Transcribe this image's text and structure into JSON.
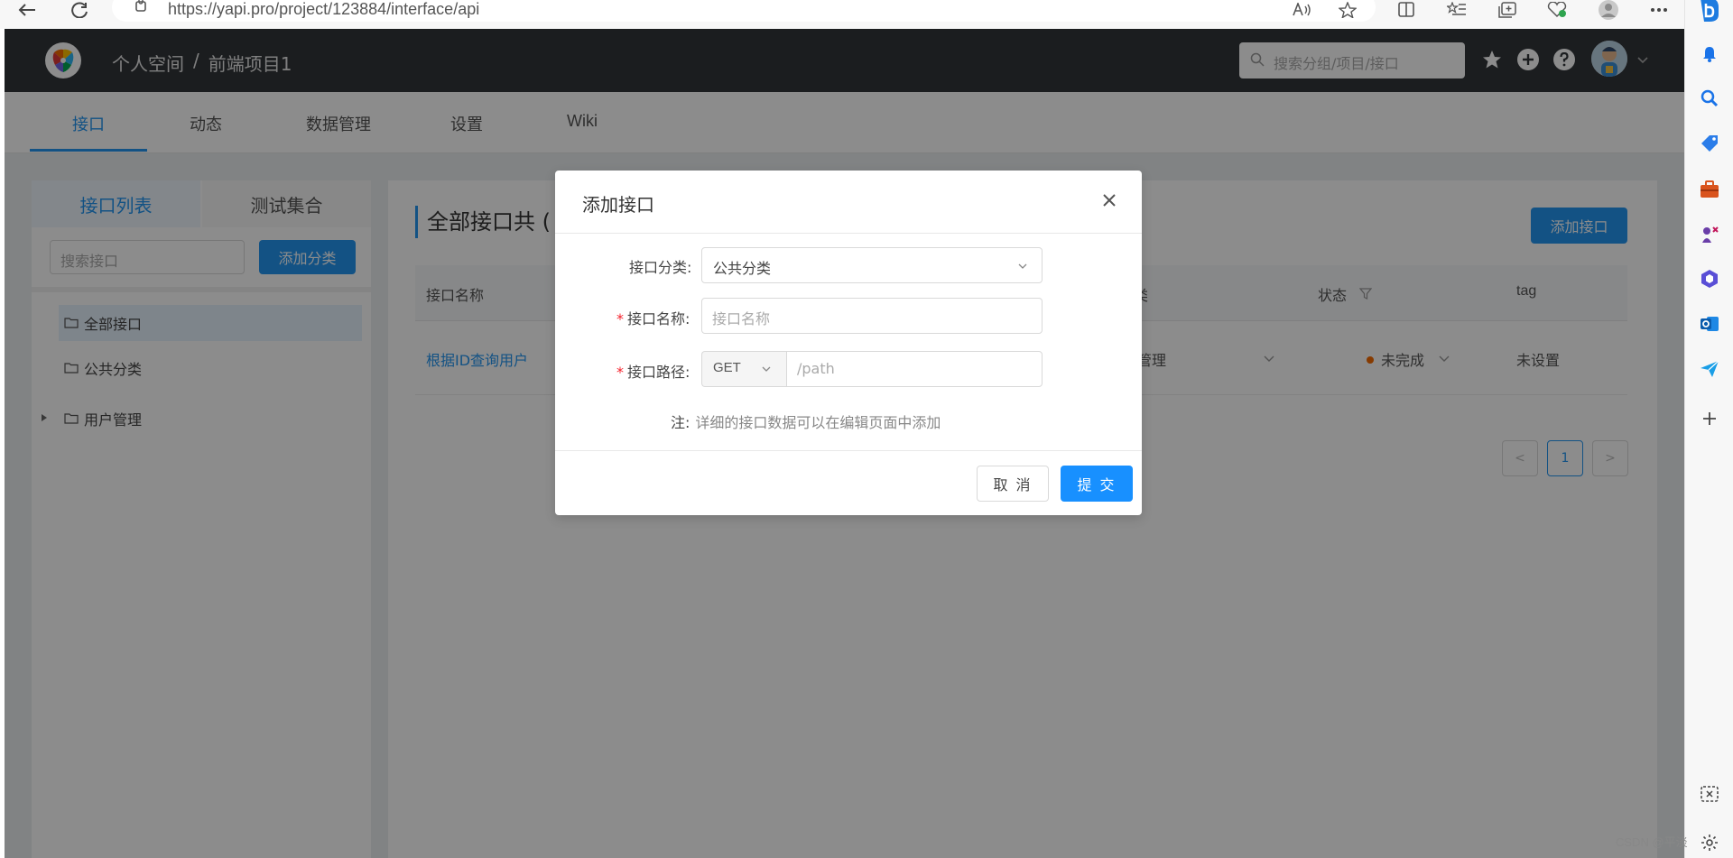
{
  "browser": {
    "url": "https://yapi.pro/project/123884/interface/api"
  },
  "header": {
    "breadcrumb_root": "个人空间",
    "breadcrumb_sep": "/",
    "breadcrumb_project": "前端项目1",
    "search_placeholder": "搜索分组/项目/接口"
  },
  "subnav": {
    "tabs": [
      {
        "label": "接口",
        "active": true
      },
      {
        "label": "动态"
      },
      {
        "label": "数据管理"
      },
      {
        "label": "设置"
      },
      {
        "label": "Wiki"
      }
    ]
  },
  "sidebar": {
    "tabs": [
      "接口列表",
      "测试集合"
    ],
    "search_placeholder": "搜索接口",
    "add_category_label": "添加分类",
    "items": [
      {
        "label": "全部接口",
        "selected": true
      },
      {
        "label": "公共分类"
      },
      {
        "label": "用户管理",
        "expandable": true
      }
    ]
  },
  "main": {
    "title": "全部接口共 (",
    "add_button": "添加接口",
    "columns": [
      "接口名称",
      "类",
      "状态",
      "tag"
    ],
    "rows": [
      {
        "name": "根据ID查询用户",
        "category": "管理",
        "status": "未完成",
        "tag": "未设置"
      }
    ],
    "page": "1",
    "pager_prev": "<",
    "pager_next": ">"
  },
  "modal": {
    "title": "添加接口",
    "category_label": "接口分类:",
    "category_value": "公共分类",
    "name_label": "接口名称:",
    "name_placeholder": "接口名称",
    "path_label": "接口路径:",
    "method_value": "GET",
    "path_placeholder": "/path",
    "note_label": "注:",
    "note_text": "详细的接口数据可以在编辑页面中添加",
    "cancel_label": "取 消",
    "submit_label": "提 交",
    "required_mark": "*"
  },
  "watermark": "CSDN @平淡",
  "colors": {
    "primary": "#2395f1",
    "header_bg": "#32363a",
    "status_dot": "#f56a00"
  }
}
